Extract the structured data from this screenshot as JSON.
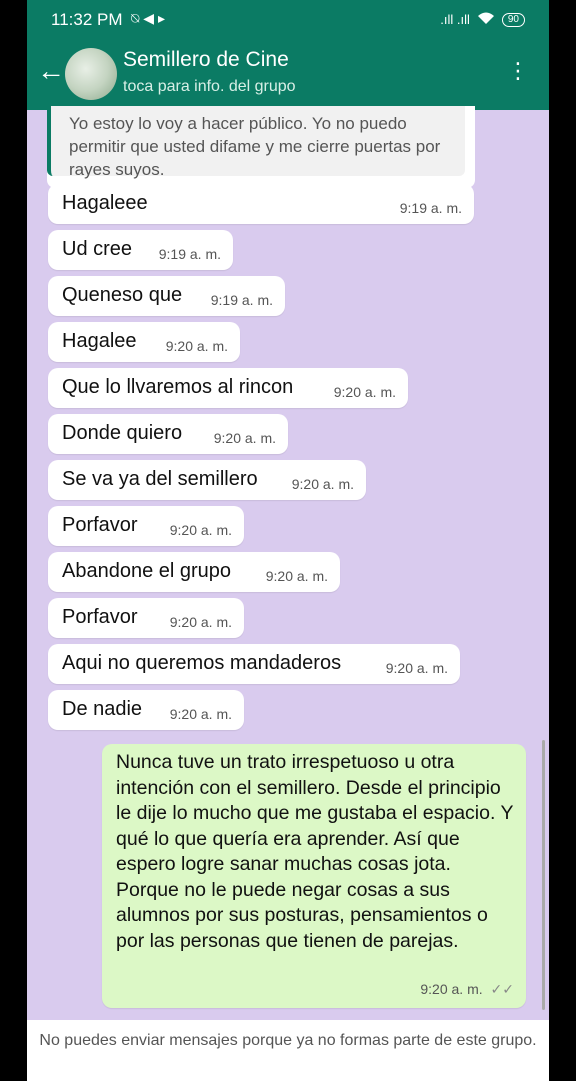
{
  "status_bar": {
    "time": "11:32 PM",
    "icons": "⍉ ◀ ▸",
    "signal": ".ıll .ıll",
    "battery": "90"
  },
  "header": {
    "back_icon": "←",
    "title": "Semillero de Cine",
    "subtitle": "toca para info. del grupo",
    "menu_icon": "⋮"
  },
  "quoted_message": {
    "text": "Yo estoy lo voy a hacer público. Yo no puedo permitir que usted difame y me cierre puertas por rayes suyos."
  },
  "messages": [
    {
      "text": "Hagaleee",
      "time": "9:19 a. m."
    },
    {
      "text": "Ud cree",
      "time": "9:19 a. m."
    },
    {
      "text": "Queneso que",
      "time": "9:19 a. m."
    },
    {
      "text": "Hagalee",
      "time": "9:20 a. m."
    },
    {
      "text": "Que lo llvaremos al rincon",
      "time": "9:20 a. m."
    },
    {
      "text": "Donde quiero",
      "time": "9:20 a. m."
    },
    {
      "text": "Se va ya del semillero",
      "time": "9:20 a. m."
    },
    {
      "text": "Porfavor",
      "time": "9:20 a. m."
    },
    {
      "text": "Abandone el grupo",
      "time": "9:20 a. m."
    },
    {
      "text": "Porfavor",
      "time": "9:20 a. m."
    },
    {
      "text": "Aqui no queremos mandaderos",
      "time": "9:20 a. m."
    },
    {
      "text": "De nadie",
      "time": "9:20 a. m."
    }
  ],
  "outgoing_message": {
    "text": "Nunca tuve un trato irrespetuoso u otra intención con el semillero. Desde el principio le dije lo mucho que me gustaba el espacio. Y qué lo que quería era aprender. Así que espero logre sanar muchas cosas jota. Porque no le puede negar cosas a sus alumnos por sus posturas, pensamientos o por las personas que tienen de parejas.",
    "time": "9:20 a. m.",
    "read_icon": "✓✓"
  },
  "footer": {
    "notice": "No puedes enviar mensajes porque ya no formas parte de este grupo."
  },
  "colors": {
    "header": "#0b7b64",
    "chat_background": "#d9cbee",
    "incoming": "#ffffff",
    "outgoing": "#dcf8c6"
  }
}
